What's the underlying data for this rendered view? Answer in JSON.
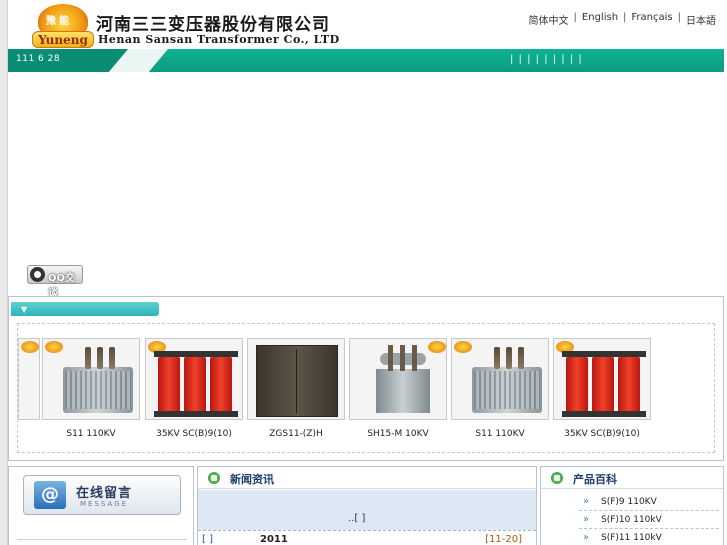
{
  "header": {
    "logo_cn": "豫能",
    "logo_en": "Yuneng",
    "company_cn": "河南三三变压器股份有限公司",
    "company_en": "Henan Sansan  Transformer Co., LTD",
    "languages": [
      {
        "label": "简体中文"
      },
      {
        "label": "English"
      },
      {
        "label": "Français"
      },
      {
        "label": "日本語"
      }
    ]
  },
  "nav": {
    "left_text": "111 6 28",
    "right_text": "| | | | | | | | |"
  },
  "qq": {
    "label": "QQ交谈"
  },
  "showcase": {
    "tab_symbol": "▼",
    "products": [
      {
        "caption": "S11  110KV",
        "type": "grey"
      },
      {
        "caption": "35KV SC(B)9(10)",
        "type": "red"
      },
      {
        "caption": "ZGS11-(Z)H",
        "type": "box"
      },
      {
        "caption": "SH15-M  10KV",
        "type": "tank"
      },
      {
        "caption": "S11  110KV",
        "type": "grey"
      },
      {
        "caption": "35KV SC(B)9(10)",
        "type": "red"
      }
    ]
  },
  "message": {
    "icon_symbol": "@",
    "title_cn": "在线留言",
    "title_en": "MESSAGE"
  },
  "news": {
    "title": "新闻资讯",
    "link_text": "..[  ]",
    "row": {
      "bracket": "[   ]",
      "year": "2011",
      "range": "[11-20]"
    }
  },
  "products_panel": {
    "title": "产品百科",
    "items": [
      {
        "arrow": "»",
        "name": "S(F)9  110KV"
      },
      {
        "arrow": "»",
        "name": "S(F)10  110kV"
      },
      {
        "arrow": "»",
        "name": "S(F)11  110kV"
      }
    ]
  },
  "colors": {
    "nav_green": "#0c9f86",
    "panel_border": "#b9c3d4",
    "title_blue": "#1f3c6e"
  }
}
